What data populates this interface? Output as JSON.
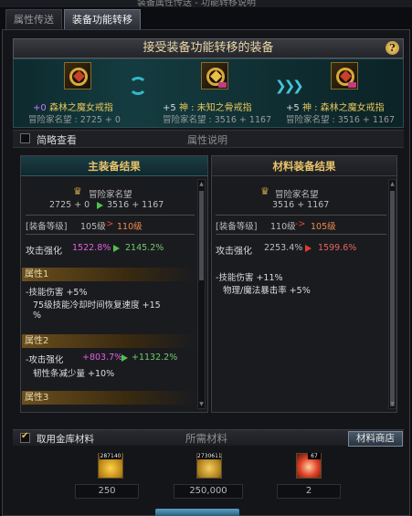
{
  "window": {
    "title_fragment": "装备属性传送 - 功能转移说明"
  },
  "tabs": [
    {
      "label": "属性传送",
      "active": false
    },
    {
      "label": "装备功能转移",
      "active": true
    }
  ],
  "header": {
    "title": "接受装备功能转移的装备",
    "help": "?"
  },
  "transfer": {
    "source": {
      "plus": "+0",
      "name": "森林之魔女戒指",
      "score_label": "冒险家名望 : 2725 + 0"
    },
    "middle": {
      "plus": "+5",
      "name": "神 : 未知之骨戒指",
      "score_label": "冒险家名望 : 3516 + 1167"
    },
    "target": {
      "plus": "+5",
      "name": "神 : 森林之魔女戒指",
      "score_label": "冒险家名望 : 3516 + 1167"
    }
  },
  "toolbar": {
    "simple_view": "简略查看",
    "attr_desc": "属性说明"
  },
  "main_result": {
    "title": "主装备结果",
    "fame_label": "冒险家名望",
    "fame_from": "2725 + 0",
    "fame_to": "3516 + 1167",
    "level_label": "[装备等级]",
    "level_from": "105级",
    "level_arrow": "->",
    "level_to": "110级",
    "atk_label": "攻击强化",
    "atk_from": "1522.8%",
    "atk_to": "2145.2%",
    "attr1_title": "属性1",
    "attr1_lines": [
      "-技能伤害 +5%",
      "75级技能冷却时间恢复速度 +15",
      "%"
    ],
    "attr2_title": "属性2",
    "attr2_line1_label": "-攻击强化",
    "attr2_line1_from": "+803.7%",
    "attr2_line1_to": "+1132.2%",
    "attr2_line2": "韧性条减少量 +10%",
    "attr3_title": "属性3"
  },
  "material_result": {
    "title": "材料装备结果",
    "fame_label": "冒险家名望",
    "fame_value": "3516 + 1167",
    "level_label": "[装备等级]",
    "level_from": "110级",
    "level_arrow": "->",
    "level_to": "105级",
    "atk_label": "攻击强化",
    "atk_from": "2253.4%",
    "atk_to": "1599.6%",
    "lines": [
      "-技能伤害 +11%",
      "物理/魔法暴击率 +5%"
    ]
  },
  "materials": {
    "use_vault": "取用金库材料",
    "title": "所需材料",
    "shop": "材料商店",
    "items": [
      {
        "icon": "gold-gem-icon",
        "count": "287140",
        "required": "250"
      },
      {
        "icon": "gold-coins-icon",
        "count": "2730611",
        "required": "250,000"
      },
      {
        "icon": "red-crystal-icon",
        "count": "67",
        "required": "2"
      }
    ]
  },
  "colors": {
    "gold": "#e8c65a",
    "cyan": "#45c4d9",
    "pink": "#e060e0",
    "green": "#74c96d",
    "red": "#e14a3f"
  }
}
